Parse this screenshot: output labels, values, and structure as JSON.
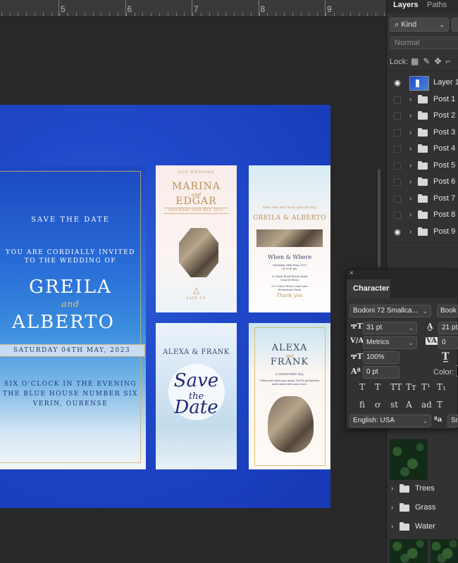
{
  "ruler": {
    "labels": [
      "5",
      "6",
      "7",
      "8",
      "9"
    ]
  },
  "canvas": {
    "main_card": {
      "save_the_date": "SAVE THE DATE",
      "invited": "YOU ARE CORDIALLY INVITED",
      "wedding_of": "TO THE WEDDING OF",
      "name1": "GREILA",
      "and": "and",
      "name2": "ALBERTO",
      "date": "SATURDAY 04TH MAY, 2023",
      "line1": "SIX O'CLOCK IN THE EVENING",
      "line2": "THE BLUE HOUSE NUMBER SIX",
      "line3": "VERIN, OURENSE"
    },
    "post1": {
      "top": "OUR WEDDING",
      "name1": "MARINA",
      "and": "and",
      "name2": "EDGAR",
      "date": "SATURDAY 24TH MAY, 2023",
      "bottom": "SAVE UP"
    },
    "post2": {
      "top": "save one our most special day",
      "names": "GREILA & ALBERTO",
      "when": "When & Where",
      "details1": "Saturday 24th May 2023",
      "details2": "At 5:00 pm",
      "details3": "22 Main Road Street Saint",
      "details4": "Church Farm",
      "details5": "22 Cotton Street Oak Lane",
      "details6": "Restaurant Farm",
      "thanks": "Thank you"
    },
    "post3": {
      "names": "ALEXA & FRANK",
      "script1": "Save",
      "script2": "the",
      "script3": "Date"
    },
    "post4": {
      "name1": "ALEXA",
      "and": "and",
      "name2": "FRANK",
      "tagline": "a memorable day",
      "body": "Ullam aute natus ipsa sequi. Sed ut perspiciatis unde omnis iste natus error."
    }
  },
  "layers_panel": {
    "tabs": [
      "Layers",
      "Paths"
    ],
    "filter": "Kind",
    "blend_mode": "Normal",
    "lock_label": "Lock:",
    "layers": [
      {
        "name": "Layer 1",
        "visible": true,
        "type": "image"
      },
      {
        "name": "Post 1",
        "visible": false,
        "type": "group"
      },
      {
        "name": "Post 2",
        "visible": false,
        "type": "group"
      },
      {
        "name": "Post 3",
        "visible": false,
        "type": "group"
      },
      {
        "name": "Post 4",
        "visible": false,
        "type": "group"
      },
      {
        "name": "Post 5",
        "visible": false,
        "type": "group"
      },
      {
        "name": "Post 6",
        "visible": false,
        "type": "group"
      },
      {
        "name": "Post 7",
        "visible": false,
        "type": "group"
      },
      {
        "name": "Post 8",
        "visible": false,
        "type": "group"
      },
      {
        "name": "Post 9",
        "visible": true,
        "type": "group"
      }
    ],
    "lower_layers": [
      {
        "name": "Water"
      },
      {
        "name": "Trees"
      },
      {
        "name": "Grass"
      },
      {
        "name": "Water"
      }
    ]
  },
  "character_panel": {
    "title": "Character",
    "font_family": "Bodoni 72 Smallca...",
    "font_style": "Book",
    "font_size": "31 pt",
    "leading": "21 pt",
    "kerning": "Metrics",
    "tracking": "0",
    "vertical_scale": "100%",
    "baseline_shift": "0 pt",
    "color_label": "Color:",
    "language": "English: USA",
    "antialias": "Sn",
    "style_buttons": [
      "T",
      "T",
      "TT",
      "Tт",
      "T¹",
      "T₁"
    ],
    "opentype_buttons": [
      "fi",
      "ơ",
      "st",
      "A",
      "ad",
      "T"
    ]
  }
}
